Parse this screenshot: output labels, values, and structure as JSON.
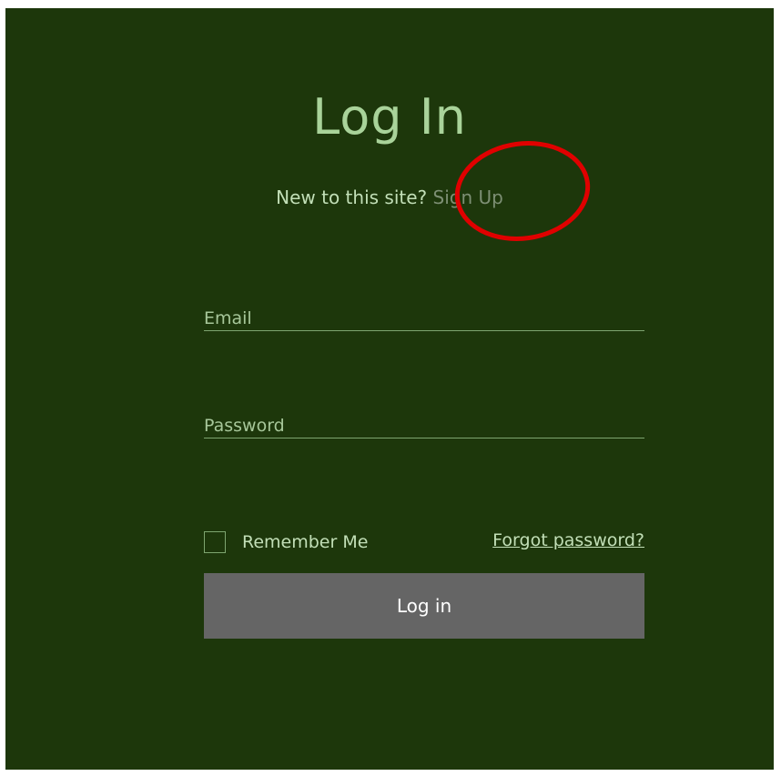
{
  "page": {
    "title": "Log In",
    "signup_prompt": "New to this site?",
    "signup_link": "Sign Up"
  },
  "form": {
    "email_placeholder": "Email",
    "email_value": "",
    "password_placeholder": "Password",
    "password_value": "",
    "remember_label": "Remember Me",
    "remember_checked": false,
    "forgot_label": "Forgot password?",
    "submit_label": "Log in"
  },
  "annotation": {
    "shape": "ellipse",
    "color": "#e00000",
    "target": "Sign Up"
  },
  "colors": {
    "background": "#1d370b",
    "title": "#a9d39a",
    "text": "#c2dfb7",
    "link_muted": "#7d8f74",
    "button": "#656565"
  }
}
